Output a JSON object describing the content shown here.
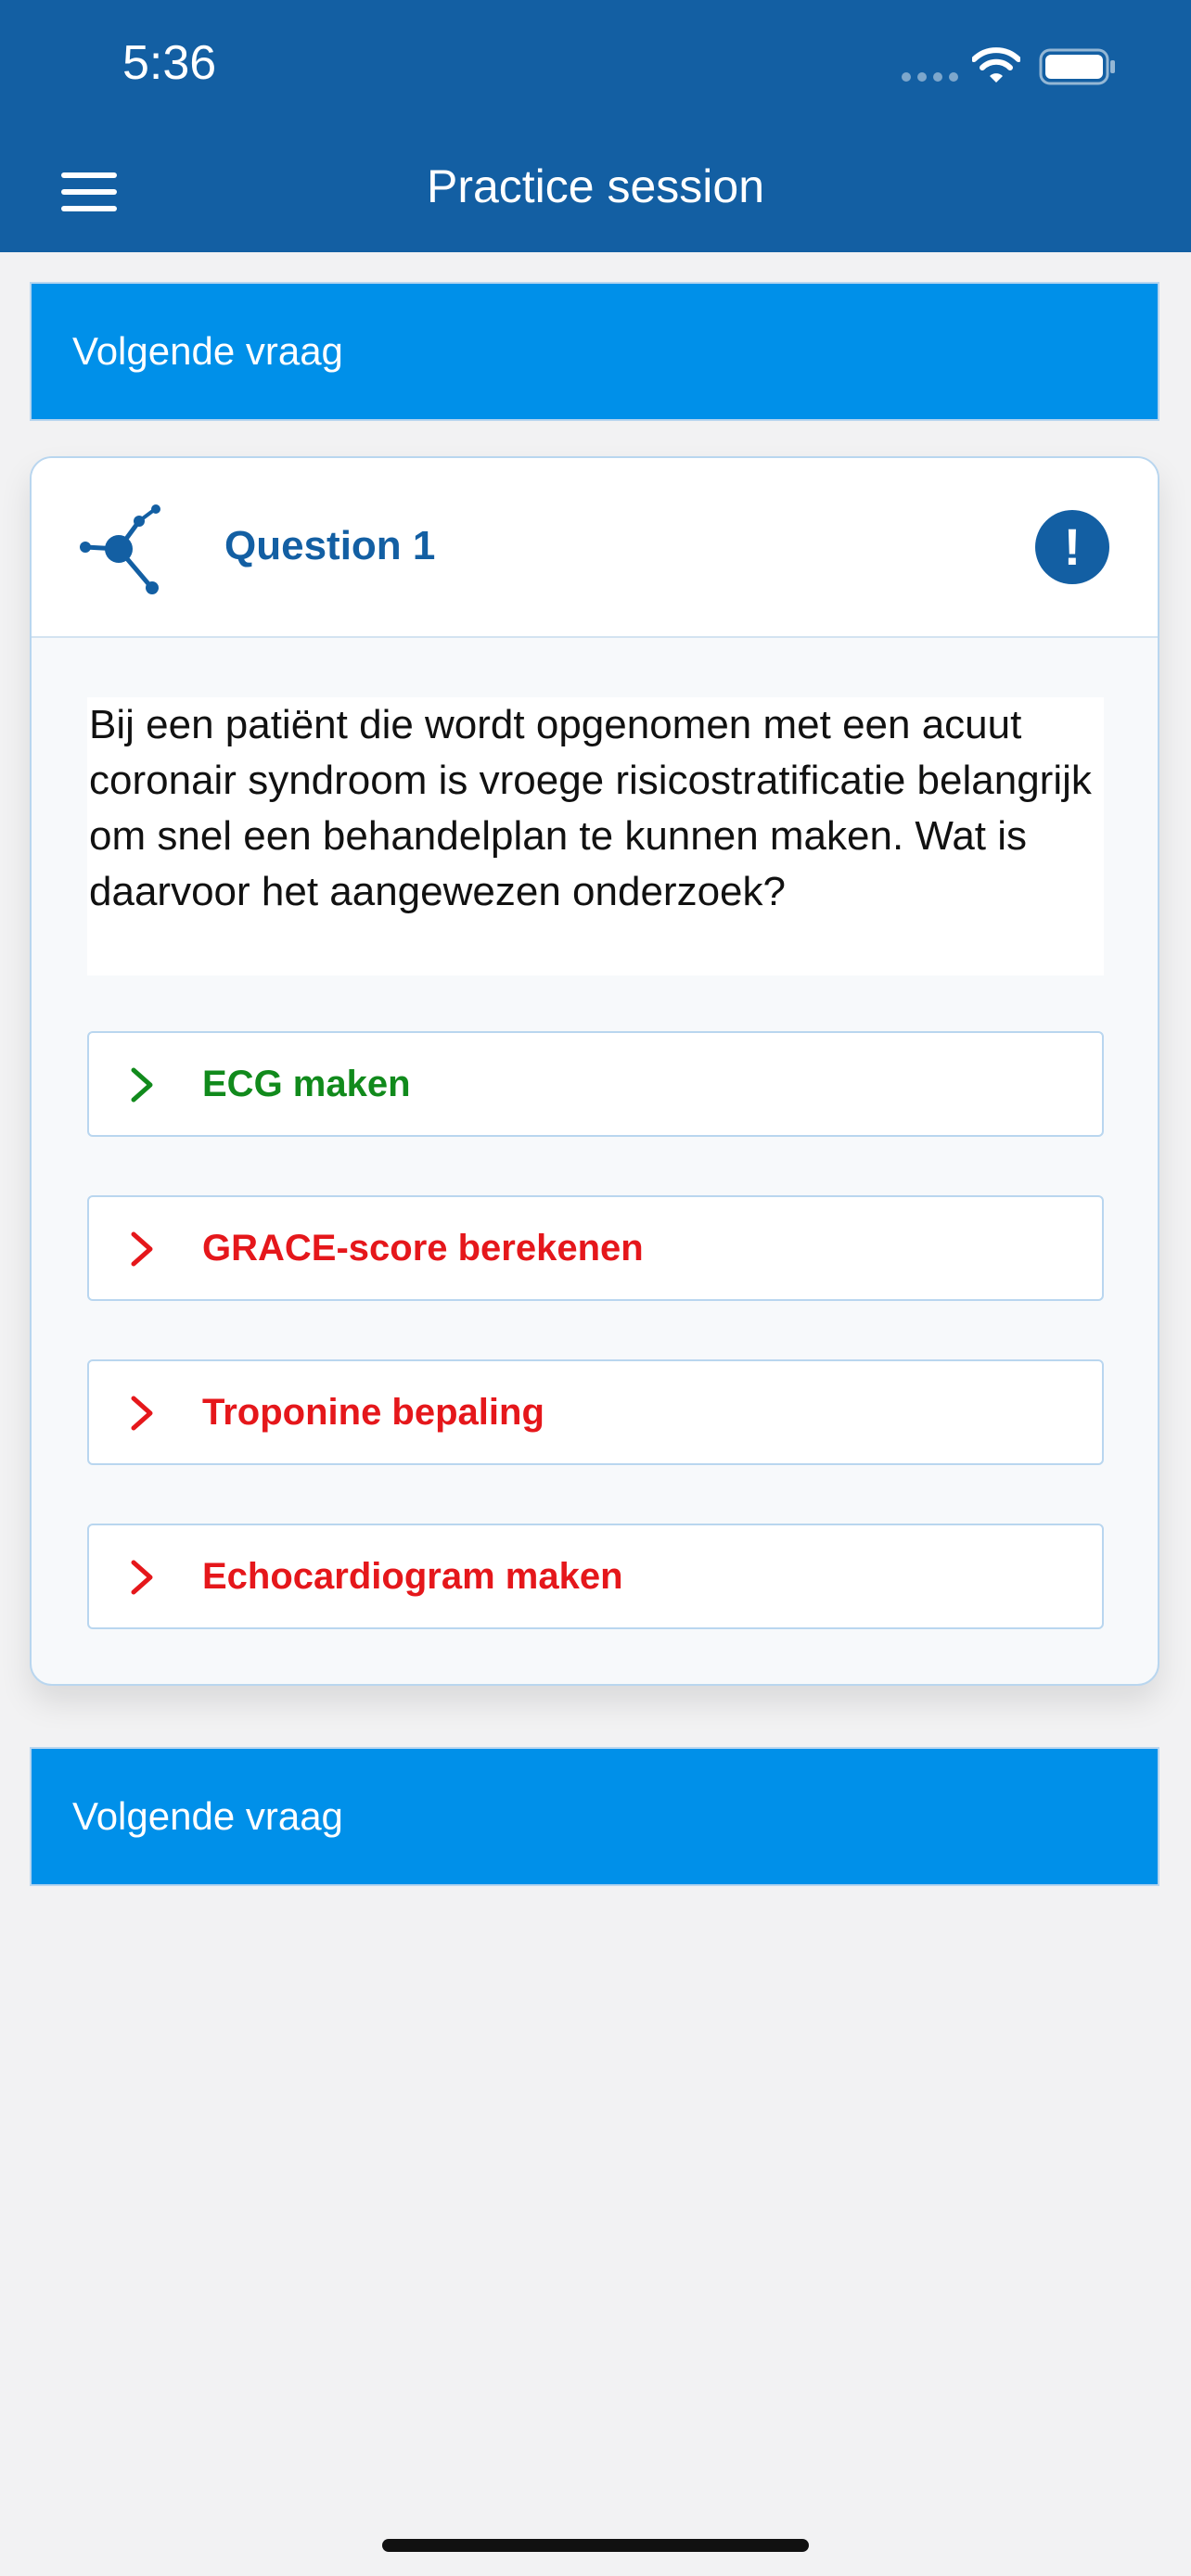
{
  "status_bar": {
    "time": "5:36"
  },
  "nav": {
    "title": "Practice session",
    "menu_icon": "hamburger-menu-icon"
  },
  "next_button_label": "Volgende vraag",
  "question": {
    "label": "Question 1",
    "icon": "network-nodes-icon",
    "alert_icon": "exclamation-icon",
    "alert_symbol": "!",
    "text": "Bij een patiënt die wordt opgenomen met een acuut coronair syndroom is vroege risicostratificatie belangrijk om snel een behandelplan te kunnen maken. Wat is daarvoor het aangewezen onderzoek?"
  },
  "answers": [
    {
      "label": "ECG maken",
      "state": "correct",
      "color": "#118a1c"
    },
    {
      "label": "GRACE-score berekenen",
      "state": "incorrect",
      "color": "#e5171b"
    },
    {
      "label": "Troponine bepaling",
      "state": "incorrect",
      "color": "#e5171b"
    },
    {
      "label": "Echocardiogram maken",
      "state": "incorrect",
      "color": "#e5171b"
    }
  ],
  "colors": {
    "header": "#135fa3",
    "button": "#0090e9",
    "correct": "#118a1c",
    "incorrect": "#e5171b"
  }
}
